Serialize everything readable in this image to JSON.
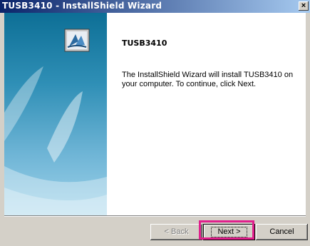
{
  "window": {
    "title": "TUSB3410 - InstallShield Wizard",
    "close_glyph": "×"
  },
  "welcome": {
    "product_name": "TUSB3410",
    "message": "The InstallShield Wizard will install TUSB3410 on your computer.  To continue, click Next."
  },
  "buttons": {
    "back": "< Back",
    "next": "Next >",
    "cancel": "Cancel"
  },
  "colors": {
    "title_bar_start": "#0a246a",
    "title_bar_end": "#a6caf0",
    "highlight": "#e01f8c"
  },
  "icons": {
    "installer": "installshield-logo-icon",
    "close": "close-icon"
  }
}
